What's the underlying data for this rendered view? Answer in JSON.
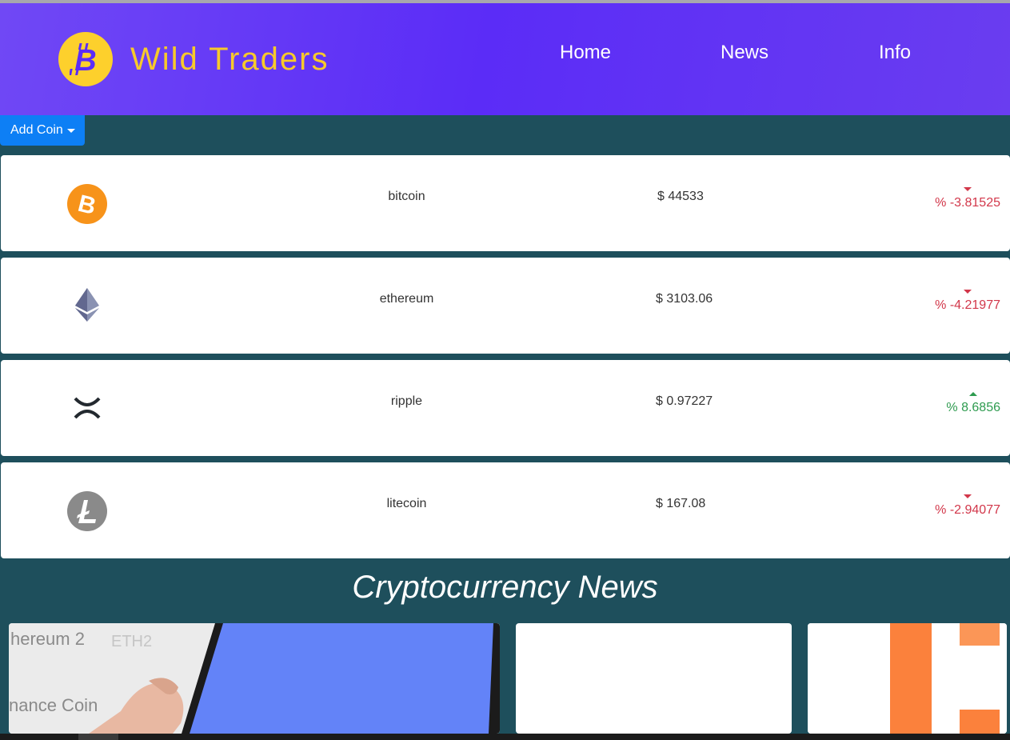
{
  "navbar": {
    "brand": "Wild Traders",
    "links": [
      "Home",
      "News",
      "Info"
    ],
    "colors": {
      "gradient_start": "#7048f5",
      "gradient_mid": "#5b2cf7",
      "brand_text": "#f7c92b",
      "logo": "#fdd02c"
    }
  },
  "toolbar": {
    "add_coin_label": "Add Coin"
  },
  "coins": [
    {
      "icon": "bitcoin-icon",
      "name": "bitcoin",
      "price": "$ 44533",
      "change": "% -3.81525",
      "direction": "down"
    },
    {
      "icon": "ethereum-icon",
      "name": "ethereum",
      "price": "$ 3103.06",
      "change": "% -4.21977",
      "direction": "down"
    },
    {
      "icon": "ripple-icon",
      "name": "ripple",
      "price": "$ 0.97227",
      "change": "% 8.6856",
      "direction": "up"
    },
    {
      "icon": "litecoin-icon",
      "name": "litecoin",
      "price": "$ 167.08",
      "change": "% -2.94077",
      "direction": "down"
    }
  ],
  "news": {
    "title": "Cryptocurrency News",
    "card1_lines": [
      "hereum 2",
      "ETH2",
      "nance Coin"
    ]
  },
  "colors": {
    "page_bg": "#1e4f5c",
    "button": "#0d7ff5",
    "negative": "#d2374a",
    "positive": "#2e9b4f"
  }
}
